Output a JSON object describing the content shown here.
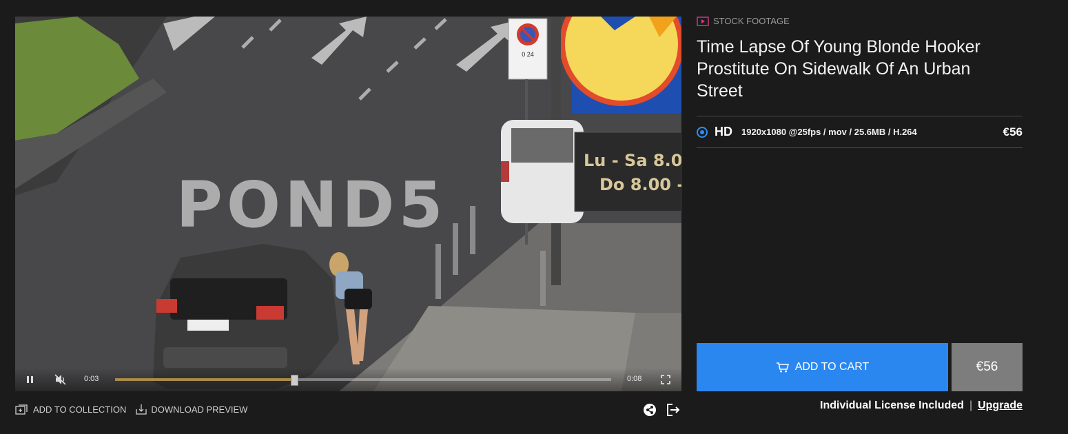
{
  "player": {
    "watermark": "POND5",
    "sign_top": "0 24",
    "sign_line1": "Lu - Sa 8.0",
    "sign_line2": "Do 8.00 -",
    "current_time": "0:03",
    "duration": "0:08",
    "progress_fraction": 0.36
  },
  "actions": {
    "add_to_collection": "ADD TO COLLECTION",
    "download_preview": "DOWNLOAD PREVIEW"
  },
  "product": {
    "category": "STOCK FOOTAGE",
    "title": "Time Lapse Of Young Blonde Hooker Prostitute On Sidewalk Of An Urban Street",
    "option": {
      "label": "HD",
      "specs": "1920x1080 @25fps / mov / 25.6MB / H.264",
      "price": "€56",
      "selected": true
    },
    "add_to_cart": "ADD TO CART",
    "price": "€56",
    "license_text": "Individual License Included",
    "separator": "|",
    "upgrade": "Upgrade"
  },
  "colors": {
    "accent": "#2a87f0",
    "category_icon": "#e0378b",
    "price_box": "#7d7d7d",
    "background": "#1b1b1b"
  },
  "icons": [
    "pause-icon",
    "mute-icon",
    "fullscreen-icon",
    "collection-icon",
    "download-icon",
    "share-icon",
    "embed-icon",
    "video-icon",
    "cart-icon"
  ]
}
